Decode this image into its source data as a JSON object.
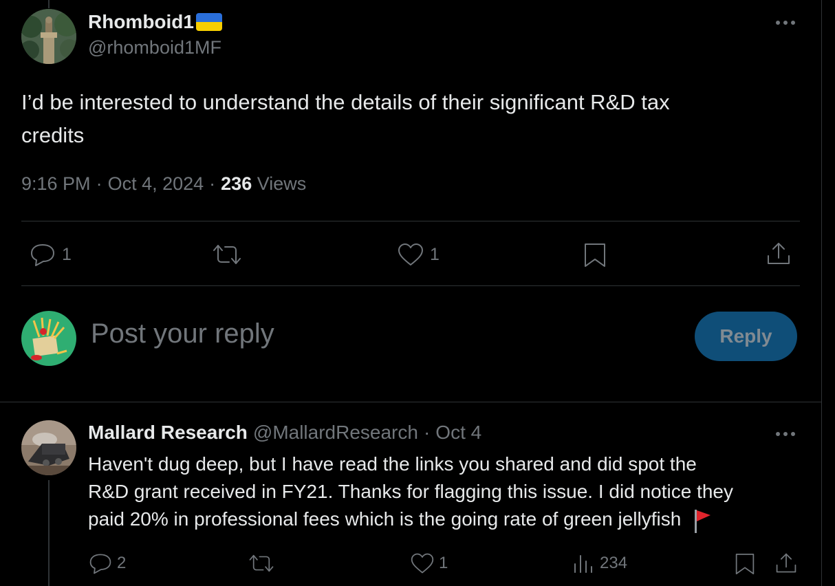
{
  "tweet": {
    "author_name": "Rhomboid1",
    "author_handle": "@rhomboid1MF",
    "text_line1": "I’d be interested to understand the details of their significant R&D tax",
    "text_line2": "credits",
    "time": "9:16 PM",
    "date": "Oct 4, 2024",
    "separator": "·",
    "views_count": "236",
    "views_label": "Views",
    "actions": {
      "replies": "1",
      "likes": "1"
    },
    "more_icon": "more-horizontal-icon",
    "flag_icon": "ukraine-flag"
  },
  "composer": {
    "placeholder": "Post your reply",
    "reply_button": "Reply",
    "button_color": "#1d9bf0"
  },
  "reply": {
    "author_name": "Mallard Research",
    "author_handle": "@MallardResearch",
    "separator": "·",
    "date": "Oct 4",
    "text_line1": "Haven't dug deep, but I have read the links you shared and did spot the",
    "text_line2": "R&D grant received in FY21. Thanks for flagging this issue.  I did notice they",
    "text_line3": "paid 20% in professional fees which is the going rate of green jellyfish",
    "emoji": "🚩",
    "actions": {
      "replies": "2",
      "likes": "1",
      "views": "234"
    }
  },
  "colors": {
    "background": "#000000",
    "text": "#e7e9ea",
    "secondary": "#71767b",
    "divider": "#2f3336",
    "accent": "#1d9bf0"
  }
}
